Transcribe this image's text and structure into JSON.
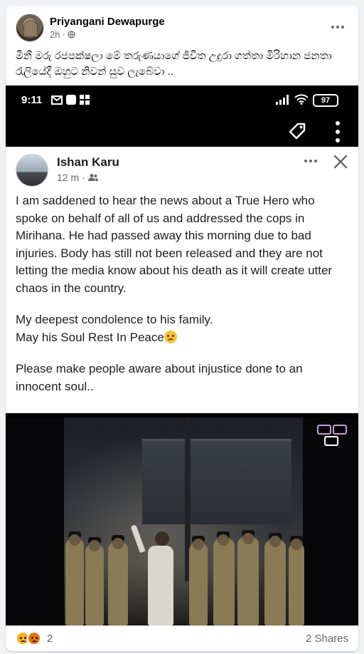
{
  "post": {
    "author": "Priyangani Dewapurge",
    "time": "2h",
    "privacy_icon": "globe-icon",
    "caption": "මිනී මරු රජපක්ෂලා මේ තරුණයාගේ ජීවිත උදුරා ගත්තා මිරිහාන ජනතා රැලියේදී ඔහුට නිවන් සුව ලැබේවා .."
  },
  "screenshot": {
    "status_bar": {
      "time": "9:11",
      "battery": "97"
    },
    "inner_post": {
      "author": "Ishan Karu",
      "time": "12 m",
      "privacy_icon": "friends-icon",
      "paragraphs": [
        "I am saddened to hear the news about a True Hero who spoke on behalf of all of us and addressed the cops in Mirihana. He had passed away this morning due to bad injuries. Body has still not been released and they are not letting the media know about his death as it will create utter chaos in the country.",
        "My deepest condolence to his family.",
        "May his Soul Rest In Peace",
        "Please make people aware about injustice done to an innocent soul.."
      ]
    }
  },
  "footer": {
    "reaction_icons": [
      "sad-reaction-icon",
      "angry-reaction-icon"
    ],
    "reaction_count": "2",
    "shares": "2 Shares"
  },
  "colors": {
    "background": "#f0f2f5",
    "secondary_text": "#65676b"
  }
}
